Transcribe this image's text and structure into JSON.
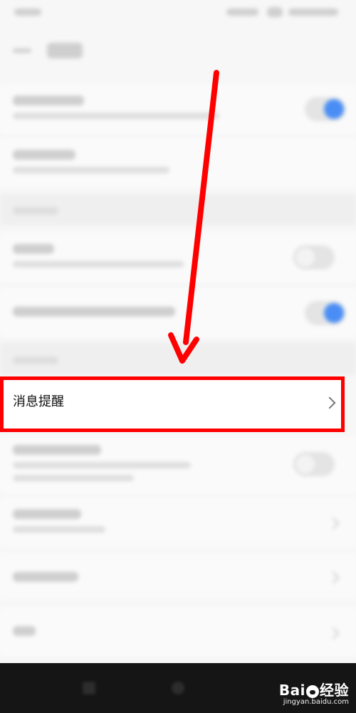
{
  "highlighted_item": {
    "label": "消息提醒"
  },
  "watermark": {
    "brand": "Bai",
    "brand_tail": "经验",
    "url": "jingyan.baidu.com"
  },
  "colors": {
    "highlight_border": "#ff0000",
    "arrow": "#ff0000",
    "toggle_on": "#4a8ef5"
  }
}
